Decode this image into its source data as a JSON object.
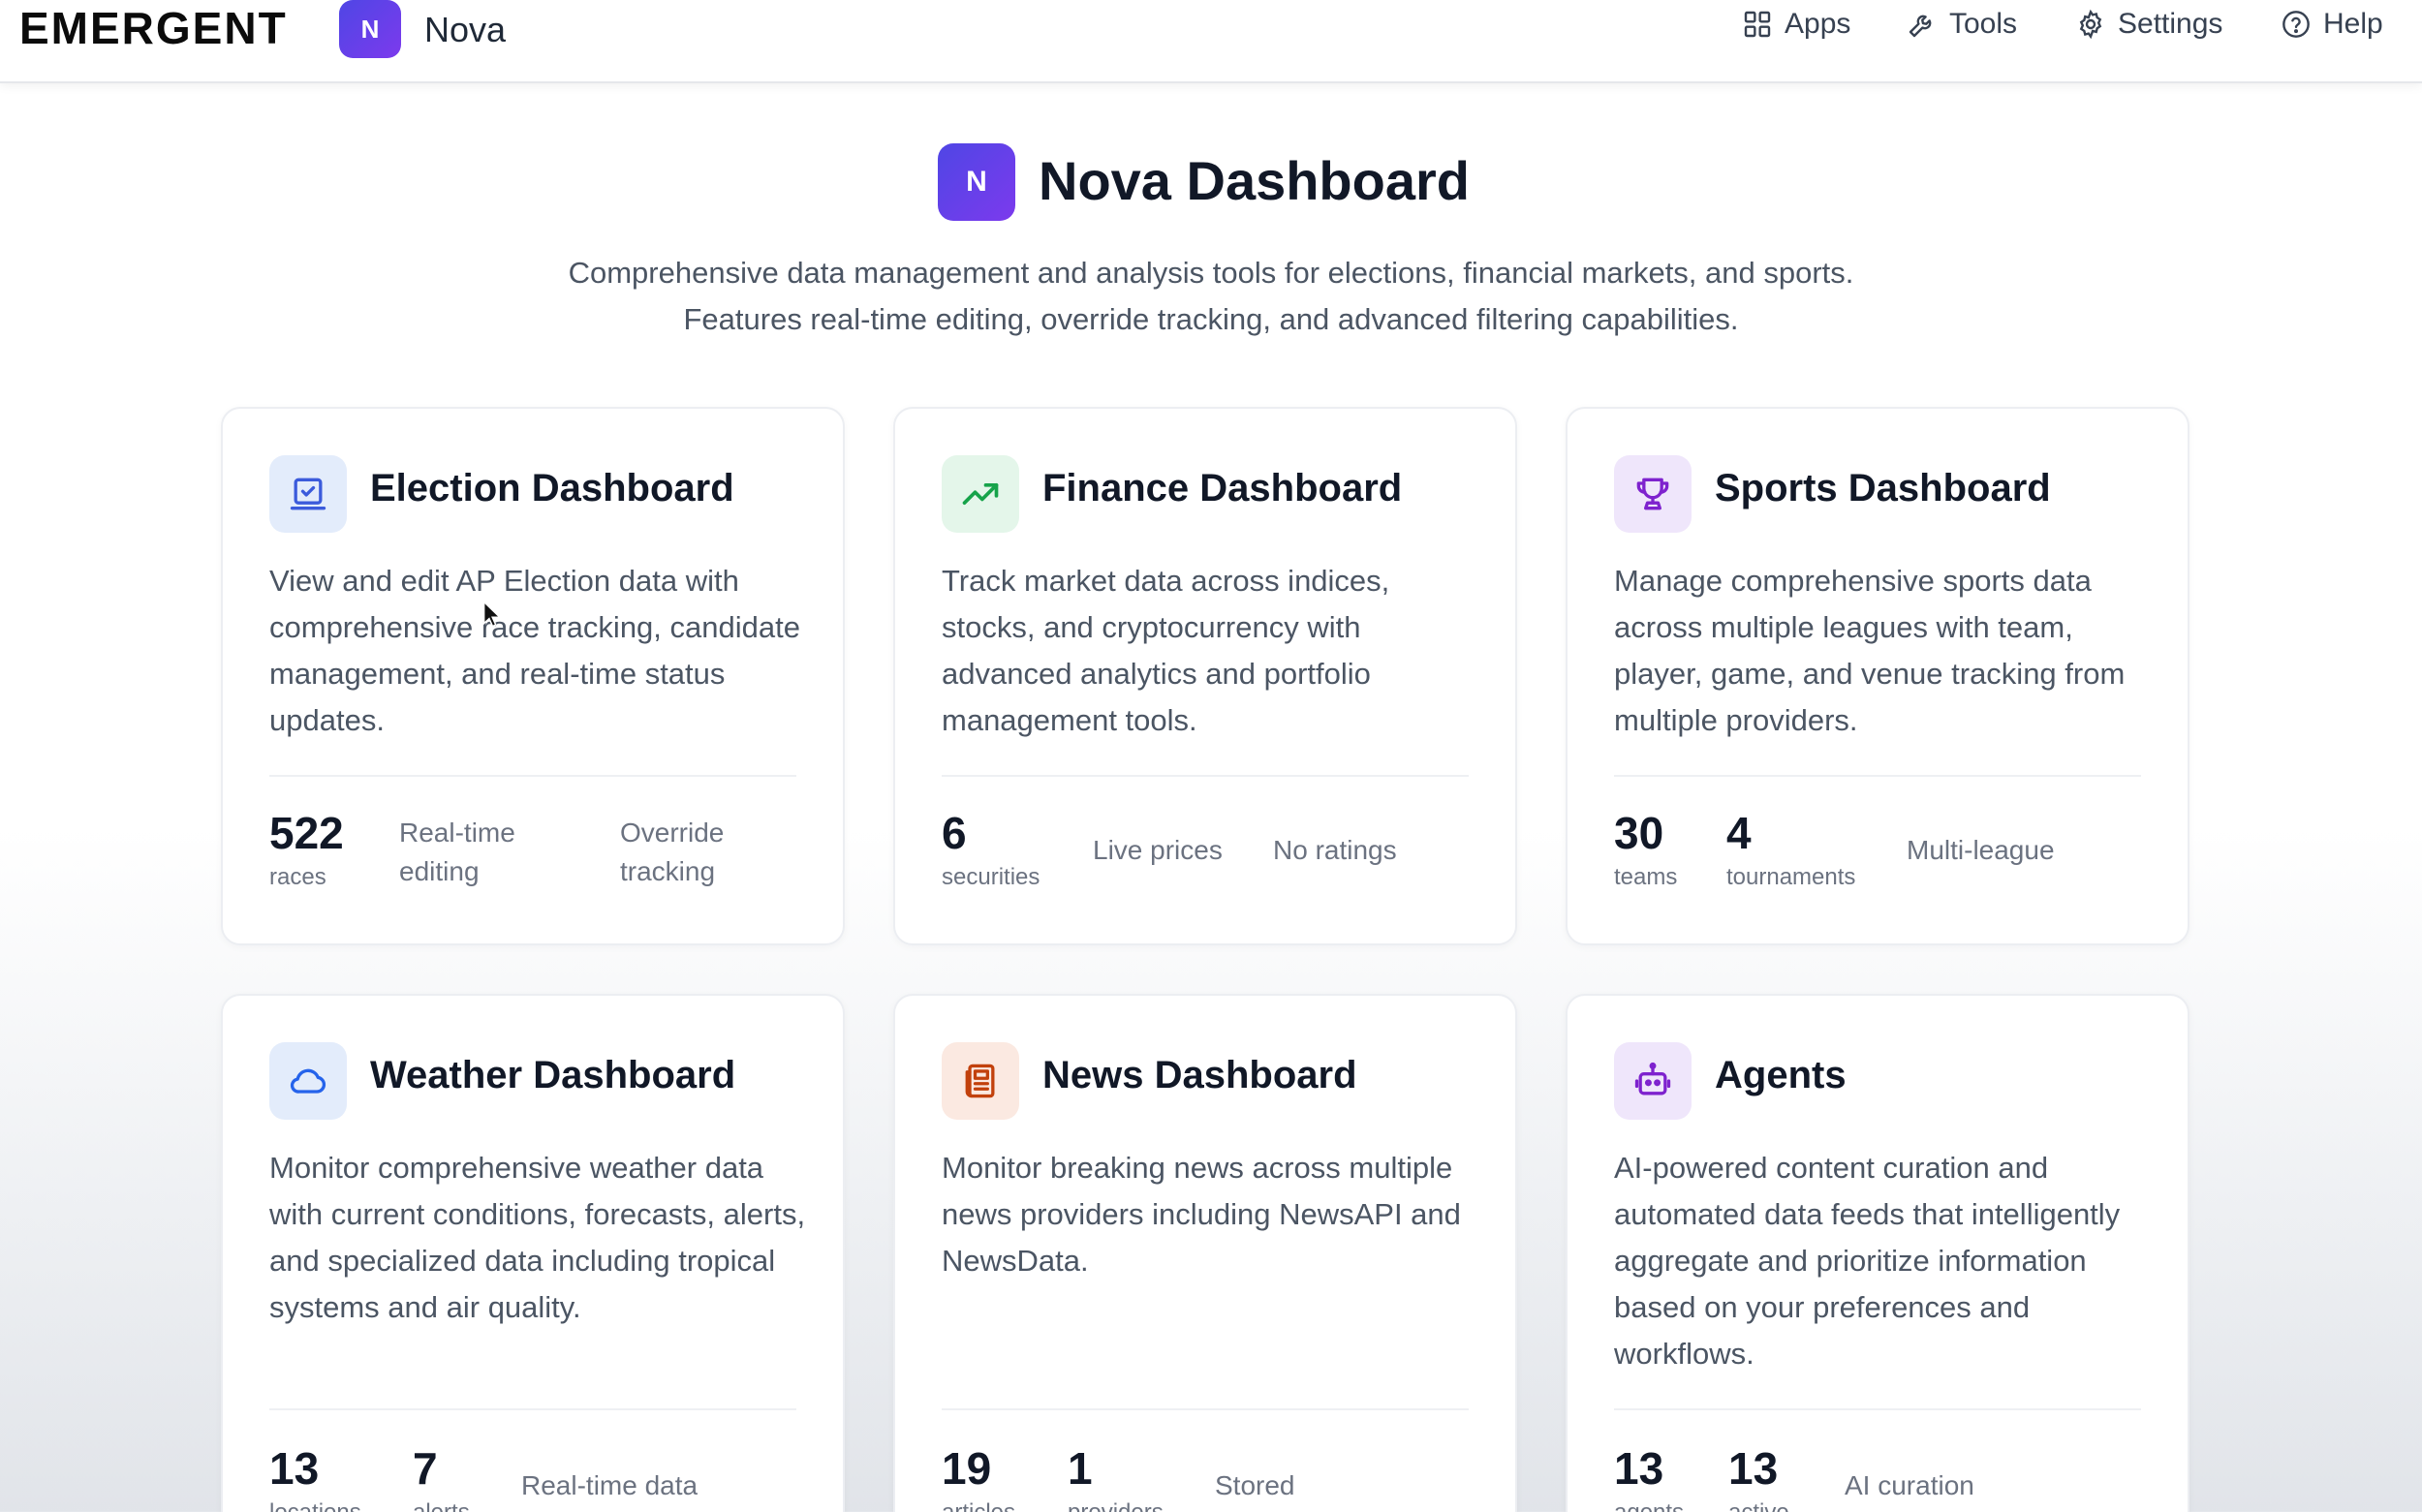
{
  "topbar": {
    "brand": "EMERGENT",
    "app_badge": "N",
    "app_name": "Nova",
    "nav": [
      {
        "label": "Apps",
        "icon": "grid-icon"
      },
      {
        "label": "Tools",
        "icon": "wrench-icon"
      },
      {
        "label": "Settings",
        "icon": "gear-icon"
      },
      {
        "label": "Help",
        "icon": "help-circle-icon"
      }
    ]
  },
  "hero": {
    "badge": "N",
    "title": "Nova Dashboard",
    "subtitle": "Comprehensive data management and analysis tools for elections, financial markets, and sports. Features real-time editing, override tracking, and advanced filtering capabilities."
  },
  "cards": [
    {
      "title": "Election Dashboard",
      "icon": "ballot-icon",
      "description": "View and edit AP Election data with comprehensive race tracking, candidate management, and real-time status updates.",
      "stats": [
        {
          "value": "522",
          "label": "races"
        }
      ],
      "features": [
        "Real-time editing",
        "Override tracking"
      ]
    },
    {
      "title": "Finance Dashboard",
      "icon": "trending-up-icon",
      "description": "Track market data across indices, stocks, and cryptocurrency with advanced analytics and portfolio management tools.",
      "stats": [
        {
          "value": "6",
          "label": "securities"
        }
      ],
      "features": [
        "Live prices",
        "No ratings"
      ]
    },
    {
      "title": "Sports Dashboard",
      "icon": "trophy-icon",
      "description": "Manage comprehensive sports data across multiple leagues with team, player, game, and venue tracking from multiple providers.",
      "stats": [
        {
          "value": "30",
          "label": "teams"
        },
        {
          "value": "4",
          "label": "tournaments"
        }
      ],
      "features": [
        "Multi-league"
      ]
    },
    {
      "title": "Weather Dashboard",
      "icon": "cloud-icon",
      "description": "Monitor comprehensive weather data with current conditions, forecasts, alerts, and specialized data including tropical systems and air quality.",
      "stats": [
        {
          "value": "13",
          "label": "locations"
        },
        {
          "value": "7",
          "label": "alerts"
        }
      ],
      "features": [
        "Real-time data"
      ]
    },
    {
      "title": "News Dashboard",
      "icon": "newspaper-icon",
      "description": "Monitor breaking news across multiple news providers including NewsAPI and NewsData.",
      "stats": [
        {
          "value": "19",
          "label": "articles"
        },
        {
          "value": "1",
          "label": "providers"
        }
      ],
      "features": [
        "Stored"
      ]
    },
    {
      "title": "Agents",
      "icon": "robot-icon",
      "description": "AI-powered content curation and automated data feeds that intelligently aggregate and prioritize information based on your preferences and workflows.",
      "stats": [
        {
          "value": "13",
          "label": "agents"
        },
        {
          "value": "13",
          "label": "active"
        }
      ],
      "features": [
        "AI curation"
      ]
    }
  ],
  "colors": {
    "brand_gradient_start": "#4f46e5",
    "brand_gradient_end": "#7c3aed",
    "election": "#3b5bdb",
    "finance": "#16a34a",
    "sports": "#7e22ce",
    "weather": "#2563eb",
    "news": "#c2410c",
    "agents": "#7e22ce"
  }
}
